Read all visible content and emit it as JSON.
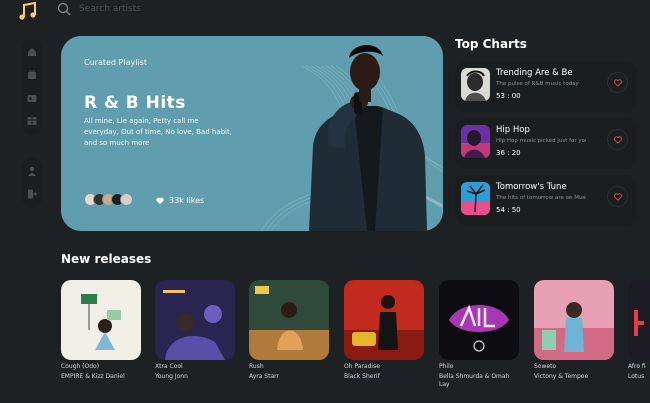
{
  "search": {
    "placeholder": "Search artists"
  },
  "hero": {
    "tag": "Curated Playlist",
    "title": "R & B Hits",
    "description": "All mine, Lie again, Petty call me everyday, Out of time, No love, Bad habit, and so much more",
    "likes": "33k likes"
  },
  "top_charts": {
    "title": "Top Charts",
    "items": [
      {
        "name": "Trending Are & Be",
        "sub": "The pulse of R&B music today",
        "duration": "53 : 00"
      },
      {
        "name": "Hip Hop",
        "sub": "Hip Hop music picked just for you",
        "duration": "36 : 20"
      },
      {
        "name": "Tomorrow's Tune",
        "sub": "The hits of tomorrow are on Musica today",
        "duration": "54 : 50"
      }
    ]
  },
  "new_releases": {
    "title": "New releases",
    "albums": [
      {
        "title": "Cough (Odo)",
        "artist": "EMPIRE & Kizz Daniel"
      },
      {
        "title": "Xtra Cool",
        "artist": "Young Jonn"
      },
      {
        "title": "Rush",
        "artist": "Ayra Starr"
      },
      {
        "title": "Oh Paradise",
        "artist": "Black Sherif"
      },
      {
        "title": "Philo",
        "artist": "Bella Shmurda & Omah Lay"
      },
      {
        "title": "Soweto",
        "artist": "Victony & Tempoe"
      },
      {
        "title": "Afro fi",
        "artist": "Lotus"
      }
    ]
  },
  "colors": {
    "background": "#1d2123",
    "hero": "#609eaf",
    "accent": "#facd66"
  }
}
